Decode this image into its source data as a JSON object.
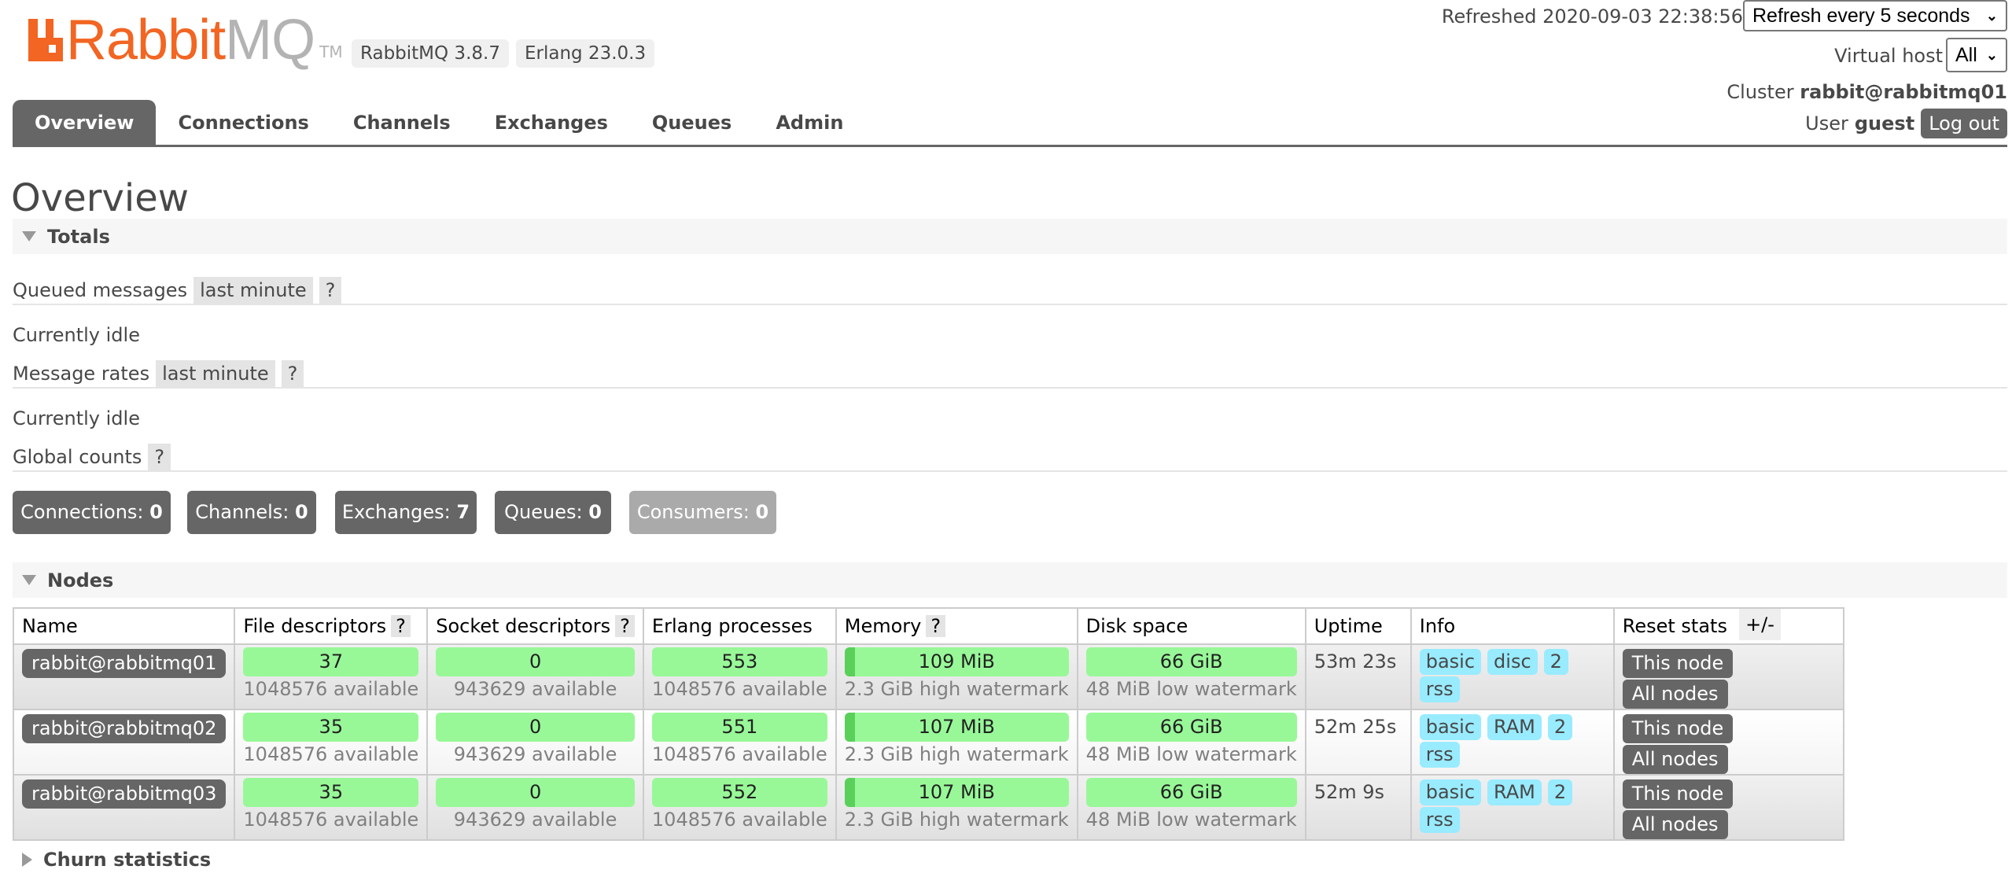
{
  "header": {
    "logo_text_primary": "Rabbit",
    "logo_text_secondary": "MQ",
    "logo_tm": "TM",
    "version_badges": [
      "RabbitMQ 3.8.7",
      "Erlang 23.0.3"
    ],
    "refreshed_label": "Refreshed 2020-09-03 22:38:56",
    "refresh_select_value": "Refresh every 5 seconds",
    "virtual_host_label": "Virtual host",
    "virtual_host_value": "All",
    "cluster_label": "Cluster",
    "cluster_name": "rabbit@rabbitmq01",
    "user_label": "User",
    "user_name": "guest",
    "logout_label": "Log out"
  },
  "tabs": [
    {
      "label": "Overview",
      "active": true
    },
    {
      "label": "Connections"
    },
    {
      "label": "Channels"
    },
    {
      "label": "Exchanges"
    },
    {
      "label": "Queues"
    },
    {
      "label": "Admin"
    }
  ],
  "page_title": "Overview",
  "totals": {
    "title": "Totals",
    "queued_messages_label": "Queued messages",
    "queued_messages_range": "last minute",
    "queued_messages_status": "Currently idle",
    "message_rates_label": "Message rates",
    "message_rates_range": "last minute",
    "message_rates_status": "Currently idle",
    "global_counts_label": "Global counts",
    "help_glyph": "?",
    "counts": [
      {
        "label": "Connections:",
        "value": "0"
      },
      {
        "label": "Channels:",
        "value": "0"
      },
      {
        "label": "Exchanges:",
        "value": "7"
      },
      {
        "label": "Queues:",
        "value": "0"
      },
      {
        "label": "Consumers:",
        "value": "0",
        "disabled": true
      }
    ]
  },
  "nodes": {
    "title": "Nodes",
    "columns": [
      "Name",
      "File descriptors",
      "Socket descriptors",
      "Erlang processes",
      "Memory",
      "Disk space",
      "Uptime",
      "Info",
      "Reset stats"
    ],
    "plus_minus": "+/-",
    "rows": [
      {
        "name": "rabbit@rabbitmq01",
        "file_descriptors": "37",
        "file_descriptors_available": "1048576 available",
        "socket_descriptors": "0",
        "socket_descriptors_available": "943629 available",
        "erlang_processes": "553",
        "erlang_processes_available": "1048576 available",
        "memory": "109 MiB",
        "memory_watermark": "2.3 GiB high watermark",
        "memory_used_fraction": 0.046,
        "disk_space": "66 GiB",
        "disk_watermark": "48 MiB low watermark",
        "uptime": "53m 23s",
        "info": [
          "basic",
          "disc",
          "2",
          "rss"
        ],
        "reset": [
          "This node",
          "All nodes"
        ]
      },
      {
        "name": "rabbit@rabbitmq02",
        "file_descriptors": "35",
        "file_descriptors_available": "1048576 available",
        "socket_descriptors": "0",
        "socket_descriptors_available": "943629 available",
        "erlang_processes": "551",
        "erlang_processes_available": "1048576 available",
        "memory": "107 MiB",
        "memory_watermark": "2.3 GiB high watermark",
        "memory_used_fraction": 0.045,
        "disk_space": "66 GiB",
        "disk_watermark": "48 MiB low watermark",
        "uptime": "52m 25s",
        "info": [
          "basic",
          "RAM",
          "2",
          "rss"
        ],
        "reset": [
          "This node",
          "All nodes"
        ]
      },
      {
        "name": "rabbit@rabbitmq03",
        "file_descriptors": "35",
        "file_descriptors_available": "1048576 available",
        "socket_descriptors": "0",
        "socket_descriptors_available": "943629 available",
        "erlang_processes": "552",
        "erlang_processes_available": "1048576 available",
        "memory": "107 MiB",
        "memory_watermark": "2.3 GiB high watermark",
        "memory_used_fraction": 0.045,
        "disk_space": "66 GiB",
        "disk_watermark": "48 MiB low watermark",
        "uptime": "52m 9s",
        "info": [
          "basic",
          "RAM",
          "2",
          "rss"
        ],
        "reset": [
          "This node",
          "All nodes"
        ]
      }
    ]
  },
  "churn": {
    "title": "Churn statistics",
    "collapsed": true
  },
  "colors": {
    "brand_orange": "#f26522",
    "tab_active": "#666666",
    "bar_green": "#98f898",
    "info_blue": "#99ebff"
  }
}
